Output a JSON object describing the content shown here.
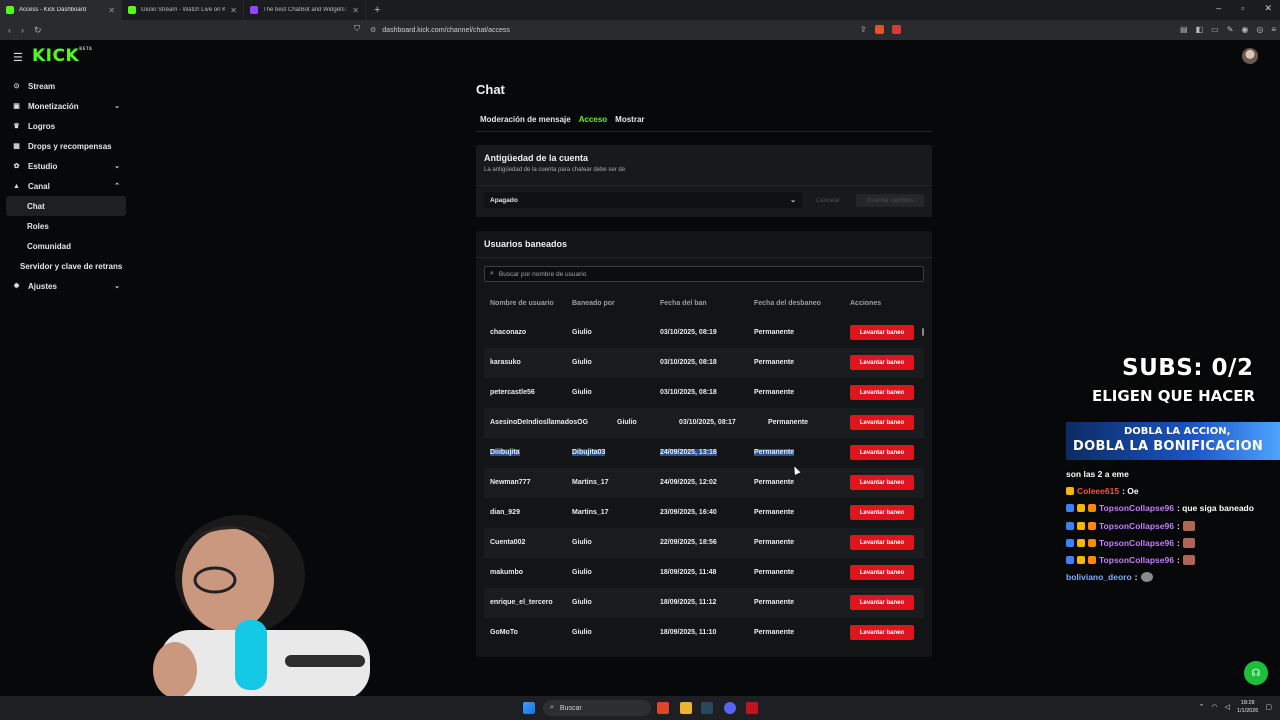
{
  "browser": {
    "tabs": [
      {
        "title": "Access - Kick Dashboard",
        "active": true
      },
      {
        "title": "Giulio Stream - Watch Live on Kick",
        "active": false
      },
      {
        "title": "The best ChatBot and Widgets for Ki",
        "active": false
      }
    ],
    "new_tab": "+",
    "url": "dashboard.kick.com/channel/chat/access"
  },
  "kick": {
    "logo": "KICK",
    "logo_beta": "BETA"
  },
  "sidebar": {
    "items": [
      {
        "label": "Stream",
        "icon": "broadcast-icon"
      },
      {
        "label": "Monetización",
        "icon": "money-icon",
        "chevron": "down"
      },
      {
        "label": "Logros",
        "icon": "trophy-icon"
      },
      {
        "label": "Drops y recompensas",
        "icon": "gift-icon"
      },
      {
        "label": "Estudio",
        "icon": "studio-icon",
        "chevron": "down"
      },
      {
        "label": "Canal",
        "icon": "channel-icon",
        "chevron": "up"
      }
    ],
    "sub_items": [
      "Chat",
      "Roles",
      "Comunidad"
    ],
    "server_item": "Servidor y clave de retrans",
    "settings": {
      "label": "Ajustes",
      "icon": "gear-icon"
    }
  },
  "page": {
    "title": "Chat",
    "tabs": [
      "Moderación de mensaje",
      "Acceso",
      "Mostrar"
    ],
    "active_tab": "Acceso"
  },
  "account_age": {
    "title": "Antigüedad de la cuenta",
    "subtitle": "La antigüedad de la cuenta para chatear debe ser de",
    "select_value": "Apagado",
    "cancel": "Cancelar",
    "save": "Guardar cambios"
  },
  "banned": {
    "title": "Usuarios baneados",
    "search_placeholder": "Buscar por nombre de usuario",
    "columns": [
      "Nombre de usuario",
      "Baneado por",
      "Fecha del ban",
      "Fecha del desbaneo",
      "Acciones"
    ],
    "action_label": "Levantar baneo",
    "rows": [
      {
        "user": "chaconazo",
        "by": "Giulio",
        "date": "03/10/2025, 08:19",
        "unban": "Permanente"
      },
      {
        "user": "karasuko",
        "by": "Giulio",
        "date": "03/10/2025, 08:18",
        "unban": "Permanente"
      },
      {
        "user": "petercastle56",
        "by": "Giulio",
        "date": "03/10/2025, 08:18",
        "unban": "Permanente"
      },
      {
        "user": "AsesinoDeIndiosllamadosOG",
        "by": "Giulio",
        "date": "03/10/2025, 08:17",
        "unban": "Permanente"
      },
      {
        "user": "Diiibujita",
        "by": "Dibujita03",
        "date": "24/09/2025, 13:16",
        "unban": "Permanente"
      },
      {
        "user": "Newman777",
        "by": "Martins_17",
        "date": "24/09/2025, 12:02",
        "unban": "Permanente"
      },
      {
        "user": "dian_929",
        "by": "Martins_17",
        "date": "23/09/2025, 16:40",
        "unban": "Permanente"
      },
      {
        "user": "Cuenta002",
        "by": "Giulio",
        "date": "22/09/2025, 18:56",
        "unban": "Permanente"
      },
      {
        "user": "makumbo",
        "by": "Giulio",
        "date": "18/09/2025, 11:48",
        "unban": "Permanente"
      },
      {
        "user": "enrique_el_tercero",
        "by": "Giulio",
        "date": "18/09/2025, 11:12",
        "unban": "Permanente"
      },
      {
        "user": "GoMoTo",
        "by": "Giulio",
        "date": "18/09/2025, 11:10",
        "unban": "Permanente"
      }
    ]
  },
  "overlay": {
    "subs": "SUBS: 0/2",
    "subtitle": "ELIGEN QUE HACER",
    "banner_line1": "DOBLA LA ACCION,",
    "banner_line2": "DOBLA LA BONIFICACION",
    "chat": [
      {
        "user": "",
        "text": "son las 2 a eme",
        "user_color": "#ffffff",
        "badges": 0
      },
      {
        "user": "Coleee615",
        "text": ": Oe",
        "user_color": "#ff4d4d",
        "badges": 1
      },
      {
        "user": "TopsonCollapse96",
        "text": ": que siga baneado",
        "user_color": "#c77dff",
        "badges": 3
      },
      {
        "user": "TopsonCollapse96",
        "text": ":",
        "user_color": "#c77dff",
        "badges": 3,
        "emote": true
      },
      {
        "user": "TopsonCollapse96",
        "text": ":",
        "user_color": "#c77dff",
        "badges": 3,
        "emote": true
      },
      {
        "user": "TopsonCollapse96",
        "text": ":",
        "user_color": "#c77dff",
        "badges": 3,
        "emote": true
      },
      {
        "user": "boliviano_deoro",
        "text": ":",
        "user_color": "#7fb2ff",
        "badges": 0,
        "emote": true
      }
    ]
  },
  "taskbar": {
    "search": "Buscar",
    "time": "18:28",
    "date": "1/1/2026"
  },
  "colors": {
    "accent": "#53fc18",
    "danger": "#e0141c",
    "selection": "#274f9a"
  }
}
